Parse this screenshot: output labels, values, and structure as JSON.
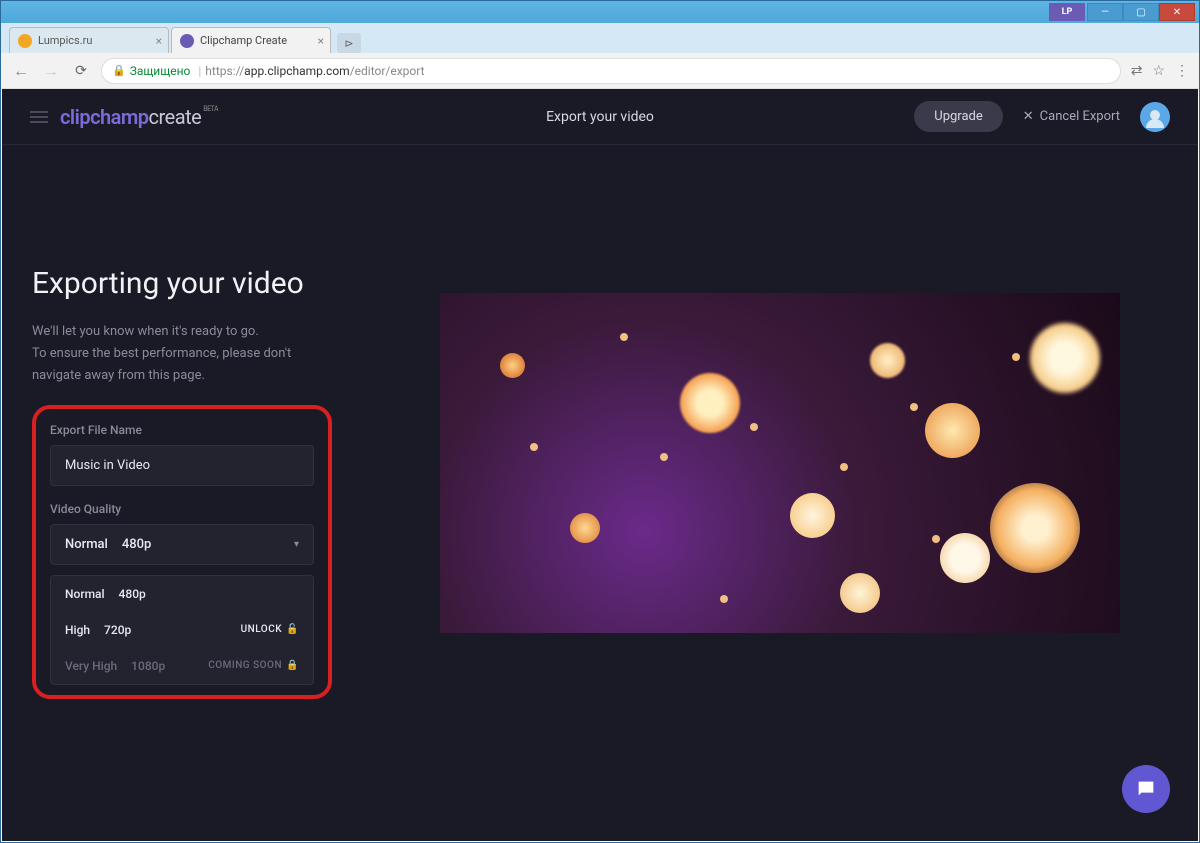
{
  "window": {
    "user_badge": "LP"
  },
  "browser": {
    "tabs": [
      {
        "title": "Lumpics.ru",
        "favicon": "fv-orange"
      },
      {
        "title": "Clipchamp Create",
        "favicon": "fv-purple"
      }
    ],
    "secure_label": "Защищено",
    "url_full": "https://app.clipchamp.com/editor/export",
    "url_host": "app.clipchamp.com",
    "url_path": "/editor/export"
  },
  "app_header": {
    "logo_part1": "clipchamp",
    "logo_part2": "create",
    "logo_badge": "BETA",
    "title": "Export your video",
    "upgrade": "Upgrade",
    "cancel": "Cancel Export"
  },
  "export": {
    "heading": "Exporting your video",
    "sub_line1": "We'll let you know when it's ready to go.",
    "sub_line2": "To ensure the best performance, please don't navigate away from this page.",
    "filename_label": "Export File Name",
    "filename_value": "Music in Video",
    "quality_label": "Video Quality",
    "selected": {
      "name": "Normal",
      "res": "480p"
    },
    "options": [
      {
        "name": "Normal",
        "res": "480p",
        "badge": ""
      },
      {
        "name": "High",
        "res": "720p",
        "badge": "UNLOCK"
      },
      {
        "name": "Very High",
        "res": "1080p",
        "badge": "COMING SOON"
      }
    ]
  }
}
